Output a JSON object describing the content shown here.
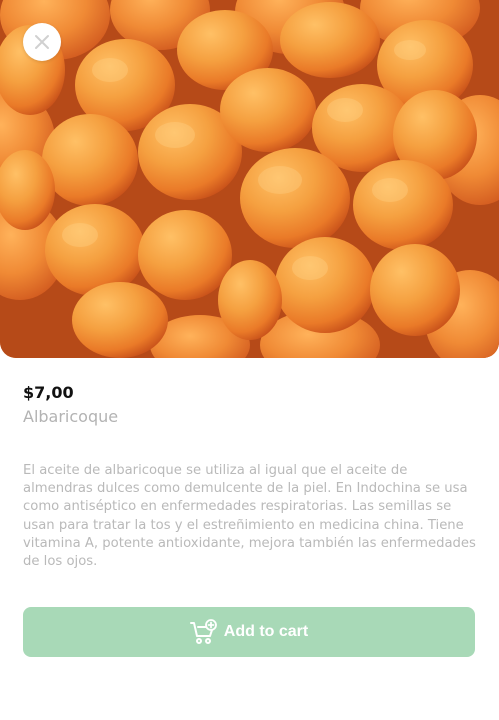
{
  "product": {
    "price": "$7,00",
    "name": "Albaricoque",
    "description": "El aceite de albaricoque se utiliza al igual que el aceite de almendras dulces como demulcente de la piel. En Indochina se usa como antiséptico en enfermedades respiratorias. Las semillas se usan para tratar la tos y el estreñimiento en medicina china. Tiene vitamina A, potente antioxidante, mejora también las enfermedades de los ojos.",
    "image_icon": "apricot-photo"
  },
  "actions": {
    "add_to_cart_label": "Add to cart",
    "add_to_cart_icon": "cart-plus-icon",
    "close_icon": "close-icon"
  },
  "colors": {
    "accent": "#a8d9b7",
    "price": "#111111",
    "muted": "#b3b3b3"
  }
}
